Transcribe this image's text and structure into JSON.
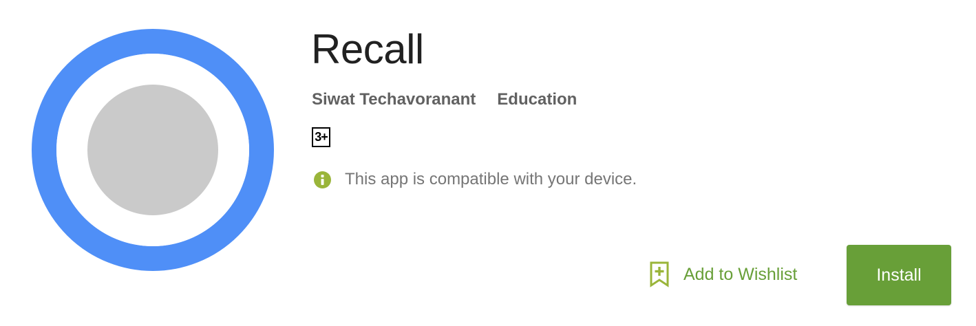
{
  "app": {
    "title": "Recall",
    "developer": "Siwat Techavoranant",
    "category": "Education",
    "content_rating": "3+",
    "compatibility": "This app is compatible with your device.",
    "icon": "app-logo-ring"
  },
  "actions": {
    "wishlist_label": "Add to Wishlist",
    "wishlist_icon": "bookmark-plus-icon",
    "install_label": "Install"
  },
  "colors": {
    "accent_green": "#689f38",
    "compat_icon_green": "#9ab53a",
    "logo_ring_blue": "#4f8ff7",
    "logo_center_gray": "#cacaca"
  }
}
